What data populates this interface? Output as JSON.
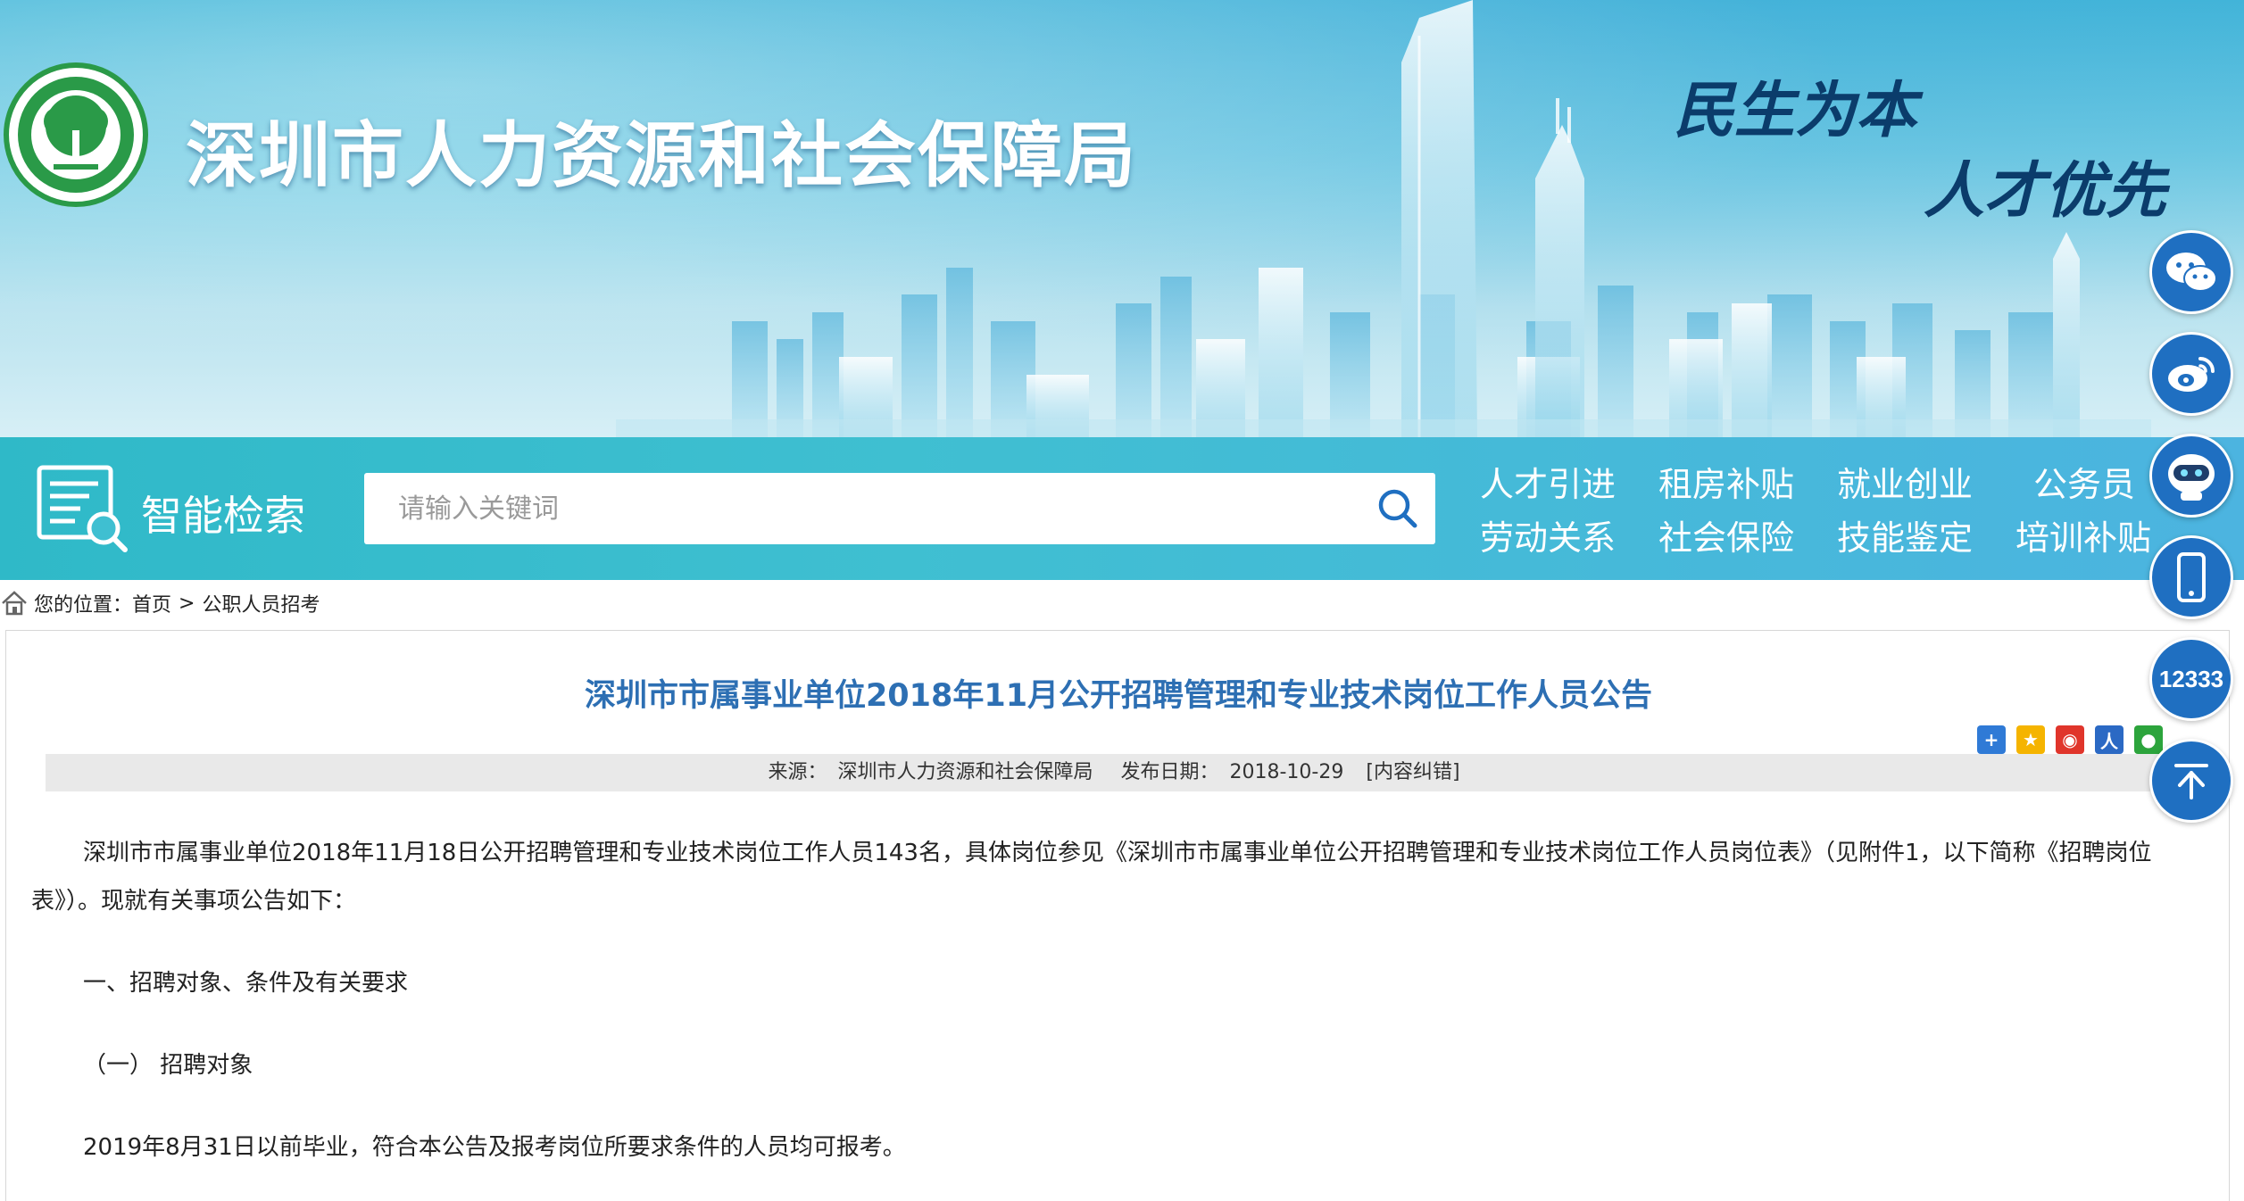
{
  "header": {
    "site_title": "深圳市人力资源和社会保障局",
    "slogan_line1": "民生为本",
    "slogan_line2": "人才优先"
  },
  "search": {
    "heading": "智能检索",
    "placeholder": "请输入关键词"
  },
  "nav": {
    "links": [
      "人才引进",
      "租房补贴",
      "就业创业",
      "公务员",
      "劳动关系",
      "社会保险",
      "技能鉴定",
      "培训补贴"
    ]
  },
  "breadcrumb": {
    "prefix": "您的位置：",
    "home": "首页",
    "separator": ">",
    "current": "公职人员招考"
  },
  "article": {
    "title": "深圳市市属事业单位2018年11月公开招聘管理和专业技术岗位工作人员公告",
    "meta": {
      "source_label": "来源：",
      "source": "深圳市人力资源和社会保障局",
      "date_label": "发布日期：",
      "date": "2018-10-29",
      "correction": "[内容纠错]"
    },
    "paragraphs": [
      "深圳市市属事业单位2018年11月18日公开招聘管理和专业技术岗位工作人员143名，具体岗位参见《深圳市市属事业单位公开招聘管理和专业技术岗位工作人员岗位表》（见附件1，以下简称《招聘岗位表》）。现就有关事项公告如下：",
      "一、招聘对象、条件及有关要求",
      "（一） 招聘对象",
      "2019年8月31日以前毕业，符合本公告及报考岗位所要求条件的人员均可报考。"
    ]
  },
  "float_bar": {
    "hotline": "12333",
    "icons": [
      "wechat-icon",
      "weibo-icon",
      "robot-icon",
      "mobile-icon",
      "hotline-12333",
      "back-to-top-icon"
    ]
  },
  "colors": {
    "accent_blue": "#2d6fb3",
    "float_blue": "#1f6fc1",
    "navbar_teal": "#3fbfd1",
    "logo_green": "#2a9a48"
  }
}
